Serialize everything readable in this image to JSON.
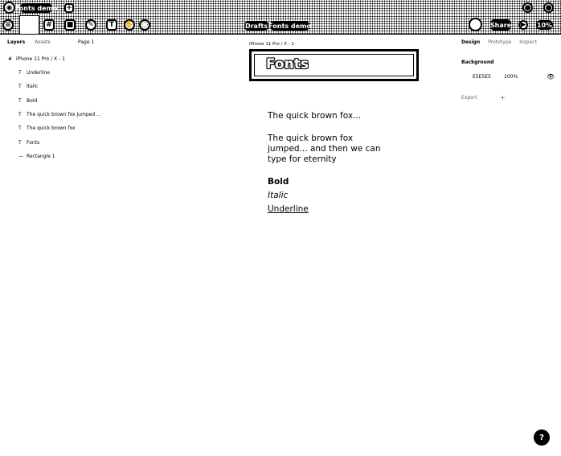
{
  "titlebar": {
    "tab_title": "Fonts demo",
    "new_tab_symbol": "+"
  },
  "toolbar": {
    "breadcrumb_drafts": "Drafts",
    "breadcrumb_file": "Fonts demo",
    "share_label": "Share",
    "zoom_label": "10%"
  },
  "left_panel": {
    "tabs": [
      "Layers",
      "Assets"
    ],
    "page": "Page 1",
    "frame_layer": "iPhone 11 Pro / X - 1",
    "layers": [
      {
        "icon": "T",
        "name": "Underline"
      },
      {
        "icon": "T",
        "name": "Italic"
      },
      {
        "icon": "T",
        "name": "Bold"
      },
      {
        "icon": "T",
        "name": "The quick brown fox jumped ..."
      },
      {
        "icon": "T",
        "name": "The quick brown fox"
      },
      {
        "icon": "T",
        "name": "Fonts"
      },
      {
        "icon": "—",
        "name": "Rectangle 1"
      }
    ]
  },
  "canvas": {
    "frame_caption": "iPhone 11 Pro / X - 1",
    "title_text": "Fonts",
    "line1": "The quick brown fox...",
    "para_line1": "The quick brown fox",
    "para_line2": "jumped... and then we can",
    "para_line3": "type for eternity",
    "bold": "Bold",
    "italic": "Italic",
    "underline": "Underline"
  },
  "right_panel": {
    "tabs": [
      "Design",
      "Prototype",
      "Inspect"
    ],
    "background_label": "Background",
    "bg_hex": "E5E5E5",
    "bg_opacity": "100%",
    "exports_label": "Export"
  },
  "help": {
    "symbol": "?"
  }
}
